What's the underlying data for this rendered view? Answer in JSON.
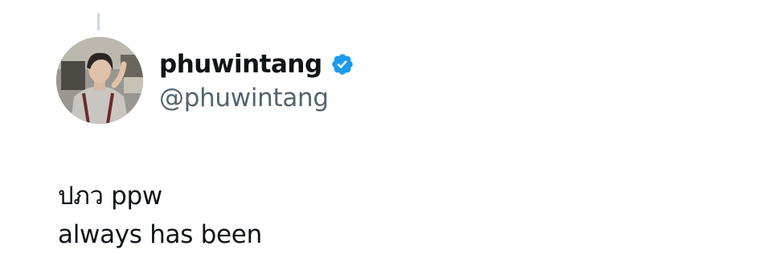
{
  "tweet": {
    "author": {
      "display_name": "phuwintang",
      "handle": "@phuwintang",
      "verified": true,
      "avatar_icon": "profile-photo"
    },
    "text_lines": [
      "ปภว ppw",
      "always has been"
    ]
  },
  "colors": {
    "verified_badge": "#1d9bf0",
    "handle_gray": "#536471",
    "thread_line": "#cfd9de"
  }
}
